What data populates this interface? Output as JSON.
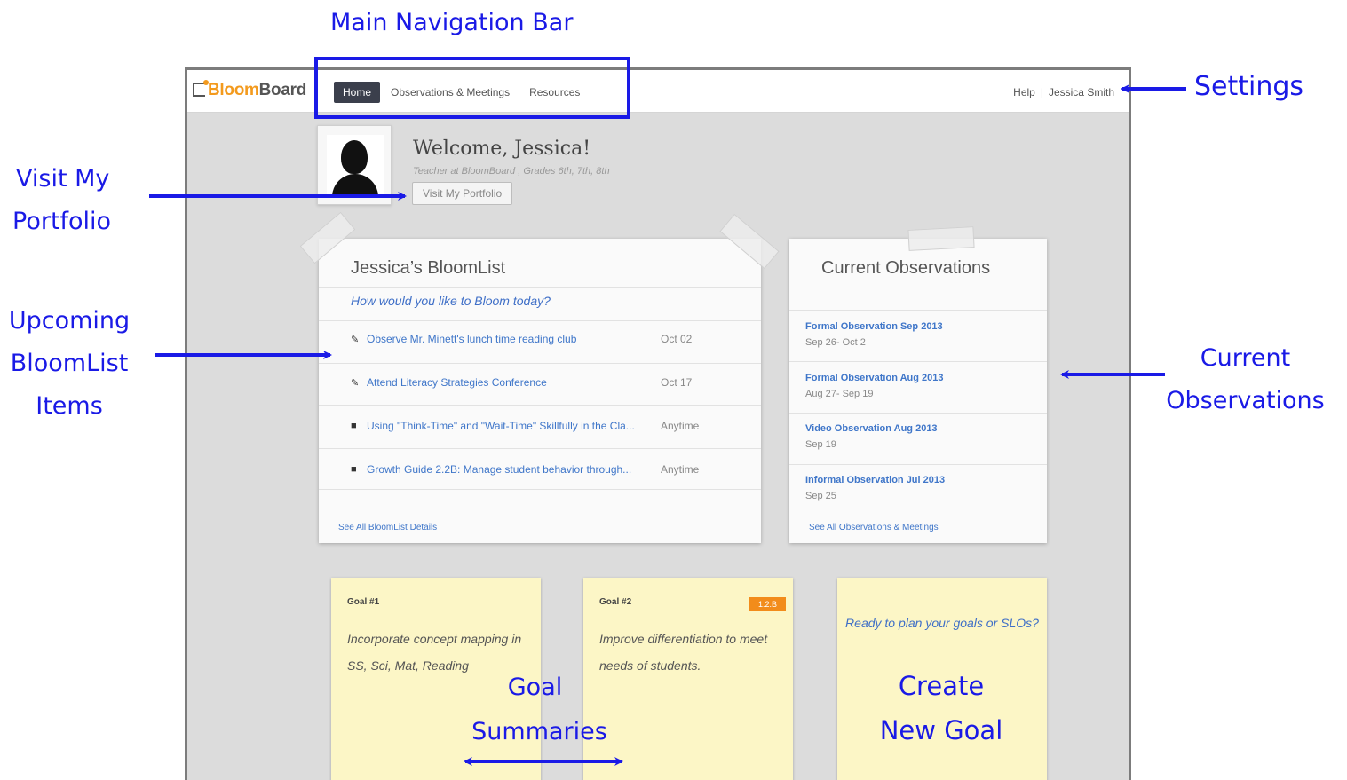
{
  "annotations": {
    "main_nav": "Main Navigation Bar",
    "settings": "Settings",
    "visit_portfolio": [
      "Visit My",
      "Portfolio"
    ],
    "upcoming": [
      "Upcoming",
      "BloomList",
      "Items"
    ],
    "current_obs": [
      "Current",
      "Observations"
    ],
    "goal_summaries": [
      "Goal",
      "Summaries"
    ]
  },
  "app": {
    "logo_bloom": "Bloom",
    "logo_board": "Board",
    "nav": [
      "Home",
      "Observations & Meetings",
      "Resources"
    ],
    "help": "Help",
    "user": "Jessica Smith",
    "welcome": "Welcome, Jessica!",
    "role": "Teacher at BloomBoard , Grades 6th, 7th, 8th",
    "portfolio_button": "Visit My Portfolio"
  },
  "bloomlist": {
    "title": "Jessica’s BloomList",
    "subtitle": "How would you like to Bloom today?",
    "items": [
      {
        "icon": "pencil-icon",
        "text": "Observe Mr. Minett's lunch time reading club",
        "date": "Oct 02"
      },
      {
        "icon": "pencil-icon",
        "text": "Attend Literacy Strategies Conference",
        "date": "Oct 17"
      },
      {
        "icon": "document-icon",
        "text": "Using \"Think-Time\" and \"Wait-Time\" Skillfully in the Cla...",
        "date": "Anytime"
      },
      {
        "icon": "document-icon",
        "text": "Growth Guide 2.2B: Manage student behavior through...",
        "date": "Anytime"
      }
    ],
    "more": "See All BloomList Details"
  },
  "observations": {
    "title": "Current Observations",
    "items": [
      {
        "name": "Formal Observation Sep 2013",
        "dates": "Sep 26- Oct 2"
      },
      {
        "name": "Formal Observation Aug 2013",
        "dates": "Aug 27- Sep 19"
      },
      {
        "name": "Video Observation Aug 2013",
        "dates": "Sep 19"
      },
      {
        "name": "Informal Observation Jul 2013",
        "dates": "Sep 25"
      }
    ],
    "more": "See All Observations & Meetings"
  },
  "goals": [
    {
      "title": "Goal #1",
      "text": "Incorporate concept mapping in SS, Sci, Mat, Reading"
    },
    {
      "title": "Goal #2",
      "text": "Improve differentiation to meet needs of students.",
      "badge": "1.2.B"
    }
  ],
  "new_goal": {
    "question": "Ready to plan your goals or SLOs?",
    "cta": [
      "Create",
      "New Goal"
    ]
  },
  "colors": {
    "accent": "#1a1ae6",
    "brand": "#f39a1d",
    "link": "#3f76c9",
    "badge": "#f28c1b"
  }
}
